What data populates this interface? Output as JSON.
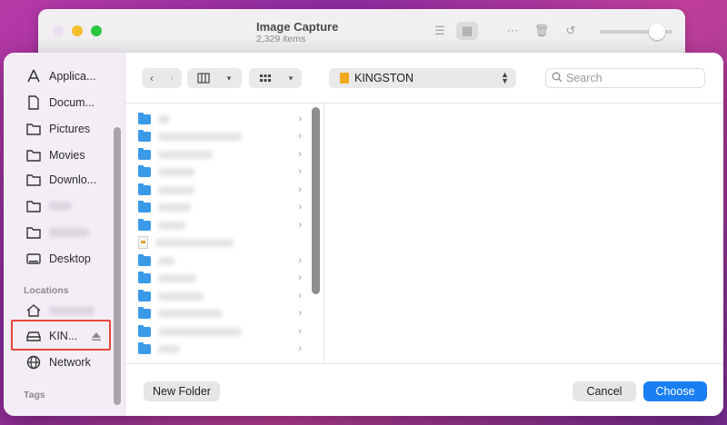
{
  "background_window": {
    "title": "Image Capture",
    "subtitle": "2,329 items"
  },
  "sidebar": {
    "favorites_items": [
      {
        "label": "Applica...",
        "icon": "applications-icon"
      },
      {
        "label": "Docum...",
        "icon": "document-icon"
      },
      {
        "label": "Pictures",
        "icon": "folder-icon"
      },
      {
        "label": "Movies",
        "icon": "folder-icon"
      },
      {
        "label": "Downlo...",
        "icon": "folder-icon"
      },
      {
        "label": "",
        "icon": "folder-icon"
      },
      {
        "label": "",
        "icon": "folder-icon"
      },
      {
        "label": "Desktop",
        "icon": "desktop-icon"
      }
    ],
    "locations_heading": "Locations",
    "locations_items": [
      {
        "label": "",
        "icon": "home-icon"
      },
      {
        "label": "KIN...",
        "icon": "drive-icon",
        "eject": true
      },
      {
        "label": "Network",
        "icon": "globe-icon"
      }
    ],
    "tags_heading": "Tags"
  },
  "toolbar": {
    "back_icon": "chevron-left-icon",
    "forward_icon": "chevron-right-icon",
    "view_columns_icon": "columns-icon",
    "view_grid_icon": "grid-icon",
    "location": "KINGSTON",
    "search_placeholder": "Search"
  },
  "file_column": {
    "rows": [
      {
        "type": "folder"
      },
      {
        "type": "folder"
      },
      {
        "type": "folder"
      },
      {
        "type": "folder"
      },
      {
        "type": "folder"
      },
      {
        "type": "folder"
      },
      {
        "type": "folder"
      },
      {
        "type": "document"
      },
      {
        "type": "folder"
      },
      {
        "type": "folder"
      },
      {
        "type": "folder"
      },
      {
        "type": "folder"
      },
      {
        "type": "folder"
      },
      {
        "type": "folder"
      }
    ]
  },
  "footer": {
    "new_folder_label": "New Folder",
    "cancel_label": "Cancel",
    "choose_label": "Choose"
  },
  "colors": {
    "accent": "#1a7ff5",
    "highlight_box": "#e8453c",
    "folder": "#3a9ae8",
    "drive": "#f0a81c"
  }
}
